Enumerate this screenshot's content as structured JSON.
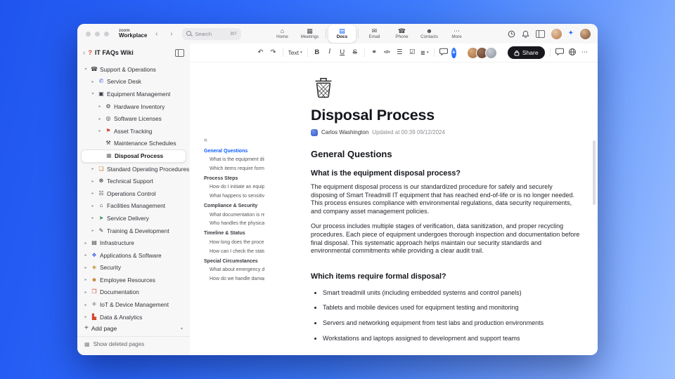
{
  "colors": {
    "accent_blue": "#0b5cff",
    "share_button_bg": "#17171c",
    "sidebar_bg": "#f7f7f8",
    "selection_bg": "#ffffff"
  },
  "glyphs": {
    "back": "‹",
    "forward": "›",
    "undo": "↶",
    "redo": "↷",
    "caret": "▾",
    "link": "⚭",
    "bullet_list": "☰",
    "check_list": "☑",
    "align": "≣",
    "ai": "✦",
    "toc_collapse": "«",
    "plus": "+",
    "add_caret": "▾",
    "deleted_icon": "▦"
  },
  "titlebar": {
    "logo_line1": "zoom",
    "logo_line2": "Workplace",
    "search_placeholder": "Search",
    "search_shortcut": "⌘F",
    "nav_items": [
      {
        "label": "Home",
        "glyph": "⌂"
      },
      {
        "label": "Meetings",
        "glyph": "▦"
      },
      {
        "label": "Docs",
        "glyph": "▤"
      },
      {
        "label": "Email",
        "glyph": "✉"
      },
      {
        "label": "Phone",
        "glyph": "☎"
      },
      {
        "label": "Contacts",
        "glyph": "☻"
      },
      {
        "label": "More",
        "glyph": "⋯"
      }
    ]
  },
  "sidebar": {
    "title": "IT FAQs Wiki",
    "title_glyph": "?",
    "add_page_label": "Add page",
    "show_deleted_label": "Show deleted pages",
    "items": [
      {
        "label": "Support & Operations",
        "glyph": "☎",
        "chev": "▾"
      },
      {
        "label": "Service Desk",
        "glyph": "✆",
        "chev": "▸"
      },
      {
        "label": "Equipment Management",
        "glyph": "▣",
        "chev": "▾"
      },
      {
        "label": "Hardware Inventory",
        "glyph": "⚙",
        "chev": "▸"
      },
      {
        "label": "Software Licenses",
        "glyph": "◎",
        "chev": "▸"
      },
      {
        "label": "Asset Tracking",
        "glyph": "⚑",
        "chev": "▸"
      },
      {
        "label": "Maintenance Schedules",
        "glyph": "⚒",
        "chev": ""
      },
      {
        "label": "Disposal Process",
        "glyph": "▦",
        "chev": ""
      },
      {
        "label": "Standard Operating Procedures",
        "glyph": "❏",
        "chev": "▸"
      },
      {
        "label": "Technical Support",
        "glyph": "☸",
        "chev": "▸"
      },
      {
        "label": "Operations Control",
        "glyph": "☵",
        "chev": "▸"
      },
      {
        "label": "Facilities Management",
        "glyph": "⌂",
        "chev": "▸"
      },
      {
        "label": "Service Delivery",
        "glyph": "➤",
        "chev": "▸"
      },
      {
        "label": "Training & Development",
        "glyph": "✎",
        "chev": "▸"
      },
      {
        "label": "Infrastructure",
        "glyph": "▤",
        "chev": "▸"
      },
      {
        "label": "Applications & Software",
        "glyph": "❖",
        "chev": "▸"
      },
      {
        "label": "Security",
        "glyph": "◈",
        "chev": "▸"
      },
      {
        "label": "Employee Resources",
        "glyph": "☻",
        "chev": "▸"
      },
      {
        "label": "Documentation",
        "glyph": "❒",
        "chev": "▸"
      },
      {
        "label": "IoT & Device Management",
        "glyph": "⚛",
        "chev": "▸"
      },
      {
        "label": "Data & Analytics",
        "glyph": "▙",
        "chev": "▸"
      }
    ]
  },
  "toolbar": {
    "text_style_label": "Text",
    "bold": "B",
    "italic": "I",
    "underline": "U",
    "strike": "S",
    "code_label": "</>",
    "share_label": "Share",
    "more_label": "⋯"
  },
  "toc": {
    "groups": [
      {
        "title": "General Questions",
        "items": [
          "What is the equipment disp...",
          "Which items require formal ..."
        ]
      },
      {
        "title": "Process Steps",
        "items": [
          "How do I initiate an equipm...",
          "What happens to sensitive ..."
        ]
      },
      {
        "title": "Compliance & Security",
        "items": [
          "What documentation is req...",
          "Who handles the physical di..."
        ]
      },
      {
        "title": "Timeline & Status",
        "items": [
          "How long does the process ...",
          "How can I check the status ..."
        ]
      },
      {
        "title": "Special Circumstances",
        "items": [
          "What about emergency dis...",
          "How do we handle damage..."
        ]
      }
    ]
  },
  "doc": {
    "title": "Disposal Process",
    "author": "Carlos Washington",
    "updated": "Updated at 00:39 09/12/2024",
    "section_heading": "General Questions",
    "q1_heading": "What is the equipment disposal process?",
    "q1_p1": "The equipment disposal process is our standardized procedure for safely and securely disposing of Smart Treadmill IT equipment that has reached end-of-life or is no longer needed. This process ensures compliance with environmental regulations, data security requirements, and company asset management policies.",
    "q1_p2": "Our process includes multiple stages of verification, data sanitization, and proper recycling procedures. Each piece of equipment undergoes thorough inspection and documentation before final disposal. This systematic approach helps maintain our security standards and environmental commitments while providing a clear audit trail.",
    "q2_heading": "Which items require formal disposal?",
    "q2_bullets": [
      "Smart treadmill units (including embedded systems and control panels)",
      "Tablets and mobile devices used for equipment testing and monitoring",
      "Servers and networking equipment from test labs and production environments",
      "Workstations and laptops assigned to development and support teams"
    ]
  }
}
